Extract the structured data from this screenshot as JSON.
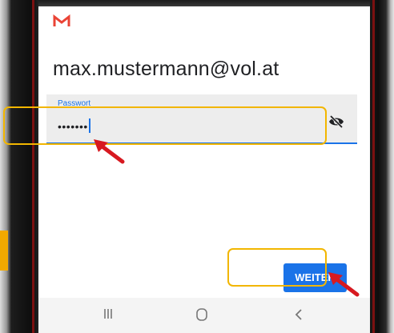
{
  "app": {
    "logo_icon": "gmail-m-icon",
    "email": "max.mustermann@vol.at"
  },
  "password_field": {
    "label": "Passwort",
    "value": "•••••••",
    "toggle_icon": "eye-off-icon"
  },
  "actions": {
    "next_label": "WEITER"
  },
  "nav_bar": {
    "items": [
      "recents-icon",
      "home-icon",
      "back-icon"
    ]
  },
  "annotations": {
    "highlight_color": "#f2b600",
    "arrow_color": "#d71920"
  },
  "colors": {
    "accent": "#1a73e8",
    "gmail_red": "#ea4335"
  }
}
